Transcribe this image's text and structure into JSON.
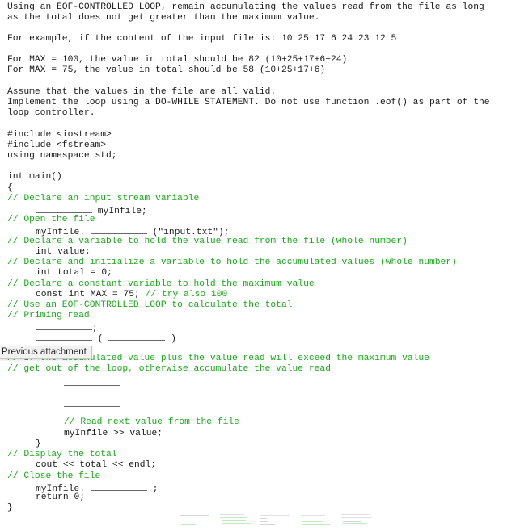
{
  "problem": {
    "intro_line1": "Using an EOF-CONTROLLED LOOP, remain accumulating the values read from the file as long",
    "intro_line2": "as the total does not get greater than the maximum value.",
    "example_line": "For example, if the content of the input file is: 10 25 17 6 24 23 12 5",
    "max100_line": "For MAX = 100, the value in total should be 82 (10+25+17+6+24)",
    "max75_line": "For MAX = 75, the value in total should be 58 (10+25+17+6)",
    "assume_line": "Assume that the values in the file are all valid.",
    "implement_line1": "Implement the loop using a DO-WHILE STATEMENT. Do not use function .eof() as part of the",
    "implement_line2": "loop controller."
  },
  "code": {
    "include1": "#include <iostream>",
    "include2": "#include <fstream>",
    "using": "using namespace std;",
    "main_sig": "int main()",
    "open_brace": "{",
    "c_declare_stream": "// Declare an input stream variable",
    "stream_var": " myInfile;",
    "c_open_file": "// Open the file",
    "open_prefix": "myInfile. ",
    "open_suffix": " (\"input.txt\");",
    "c_declare_value": "// Declare a variable to hold the value read from the file (whole number)",
    "value_decl": "int value;",
    "c_declare_total": "// Declare and initialize a variable to hold the accumulated values (whole number)",
    "total_decl": "int total = 0;",
    "c_declare_max": "// Declare a constant variable to hold the maximum value",
    "max_decl": "const int MAX = 75; ",
    "max_comment": "// try also 100",
    "c_use_loop": "// Use an EOF-CONTROLLED LOOP to calculate the total",
    "c_priming": "// Priming read",
    "semicolon": ";",
    "paren_open": " ( ",
    "paren_close": " )",
    "c_if_exceed": "// If the accumulated value plus the value read will exceed the maximum value",
    "c_get_out": "// get out of the loop, otherwise accumulate the value read",
    "c_read_next": "// Read next value from the file",
    "read_next": "myInfile >> value;",
    "inner_close": "}",
    "c_display": "// Display the total",
    "cout_line": "cout << total << endl;",
    "c_close": "// Close the file",
    "close_prefix": "myInfile. ",
    "close_suffix": " ;",
    "return_line": "return 0;",
    "close_brace": "}"
  },
  "tooltip": {
    "text": "Previous attachment"
  },
  "colors": {
    "comment": "#1aa81a",
    "text": "#1a1a1a",
    "blank_line": "#6a6a6a"
  }
}
